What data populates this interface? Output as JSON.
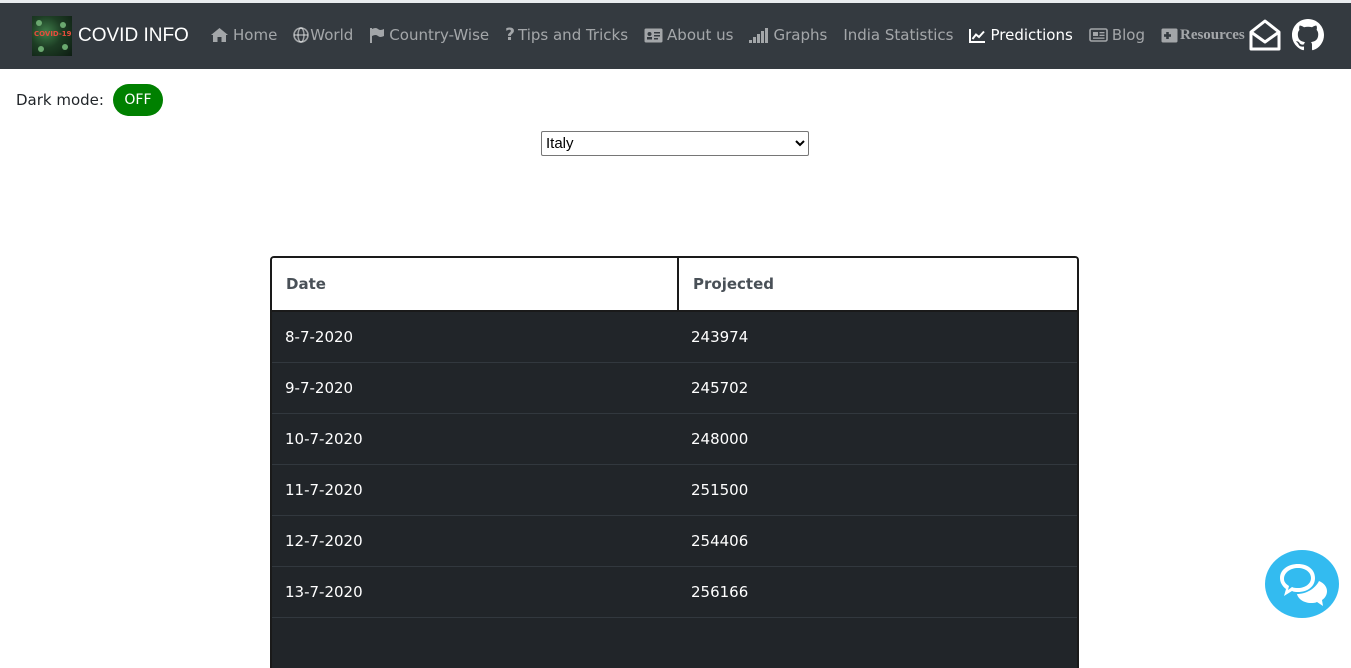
{
  "brand": {
    "title": "COVID INFO",
    "logo_text": "COVID-19"
  },
  "nav": {
    "items": [
      {
        "label": "Home",
        "icon": "home-icon"
      },
      {
        "label": "World",
        "icon": "globe-icon"
      },
      {
        "label": "Country-Wise",
        "icon": "flag-icon"
      },
      {
        "label": "Tips and Tricks",
        "icon": "question-icon"
      },
      {
        "label": "About us",
        "icon": "id-card-icon"
      },
      {
        "label": "Graphs",
        "icon": "signal-bars-icon"
      },
      {
        "label": "India Statistics",
        "icon": ""
      },
      {
        "label": "Predictions",
        "icon": "line-chart-icon",
        "active": true
      },
      {
        "label": "Blog",
        "icon": "newspaper-icon"
      },
      {
        "label": "Resources",
        "icon": "plus-square-icon"
      }
    ],
    "right_icons": [
      "mail-icon",
      "github-icon"
    ]
  },
  "dark_mode": {
    "label": "Dark mode:",
    "state": "OFF",
    "color": "#008000"
  },
  "country_select": {
    "selected": "Italy"
  },
  "table": {
    "headers": [
      "Date",
      "Projected"
    ],
    "rows": [
      [
        "8-7-2020",
        "243974"
      ],
      [
        "9-7-2020",
        "245702"
      ],
      [
        "10-7-2020",
        "248000"
      ],
      [
        "11-7-2020",
        "251500"
      ],
      [
        "12-7-2020",
        "254406"
      ],
      [
        "13-7-2020",
        "256166"
      ]
    ]
  },
  "colors": {
    "navbar": "#343a40",
    "table_body": "#212529",
    "chat_button": "#33bbf0"
  },
  "chat": {
    "icon": "chat-bubbles-icon"
  }
}
